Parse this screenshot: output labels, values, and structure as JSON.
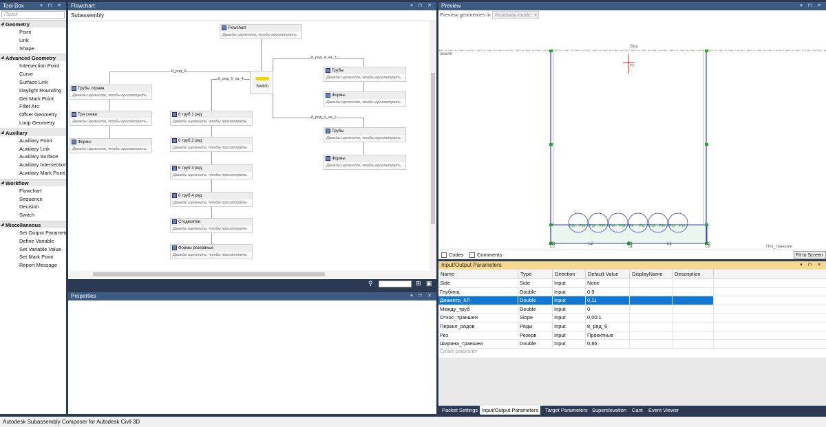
{
  "toolbox": {
    "title": "Tool Box",
    "search_placeholder": "Поиск",
    "categories": [
      {
        "name": "Geometry",
        "items": [
          "Point",
          "Link",
          "Shape"
        ]
      },
      {
        "name": "Advanced Geometry",
        "items": [
          "Intersection Point",
          "Curve",
          "Surface Link",
          "Daylight Rounding",
          "Get Mark Point",
          "Fillet Arc",
          "Offset Geometry",
          "Loop Geometry"
        ]
      },
      {
        "name": "Auxiliary",
        "items": [
          "Auxiliary Point",
          "Auxiliary Link",
          "Auxiliary Surface",
          "Auxiliary Intersection",
          "Auxiliary Mark Point"
        ]
      },
      {
        "name": "Workflow",
        "items": [
          "Flowchart",
          "Sequence",
          "Decision",
          "Switch"
        ]
      },
      {
        "name": "Miscellaneous",
        "items": [
          "Set Output Parameter",
          "Define Variable",
          "Set Variable Value",
          "Set Mark Point",
          "Report Message"
        ]
      }
    ]
  },
  "flowchart": {
    "title": "Flowchart",
    "breadcrumb": "Subassembly",
    "hint": "Дважды щелкните, чтобы просмотреть",
    "nodes": {
      "root": "Flowchart",
      "switch": "Switch",
      "a1": "Трубы справа",
      "a2": "Три слева",
      "a3": "Формы",
      "b1": "6 труб 1 ряд",
      "b2": "6 труб 2 ряд",
      "b3": "6 труб 3 ряд",
      "b4": "6 труб 4 ряд",
      "b5": "Стодесятки",
      "b6": "Формы резервные",
      "c1": "Трубы",
      "c2": "Формы",
      "d1": "Трубы",
      "d2": "Формы"
    },
    "edge_labels": {
      "left": "8_ряд_6",
      "mid": "8_ряд_6_на_4",
      "top_right": "8_ряд_4_на_3",
      "bot_right": "8_ряд_4_на_2"
    }
  },
  "preview": {
    "title": "Preview",
    "label": "Preview geometries in",
    "mode": "Roadway mode",
    "codes_label": "Codes",
    "comments_label": "Comments",
    "fit_button": "Fit to Screen",
    "axis_label": "Ось",
    "surface_label": "Земля",
    "bottom_label": "Низ_траншеи",
    "point_labels": [
      "L5",
      "S1",
      "L6",
      "P3",
      "L2",
      "P1",
      "L1",
      "P2",
      "P0"
    ],
    "pipe_labels": [
      "P20",
      "P39",
      "P18",
      "P37",
      "P16",
      "P35",
      "P8",
      "P11",
      "P28",
      "P30",
      "P12",
      "P14"
    ]
  },
  "properties": {
    "title": "Properties"
  },
  "io": {
    "title": "Input/Output Parameters",
    "columns": [
      "Name",
      "Type",
      "Direction",
      "Default Value",
      "DisplayName",
      "Description"
    ],
    "rows": [
      [
        "Side",
        "Side",
        "Input",
        "None",
        "",
        ""
      ],
      [
        "Глубина",
        "Double",
        "Input",
        "0,9",
        "",
        ""
      ],
      [
        "Диаметр_КЛ",
        "Double",
        "Input",
        "0,11",
        "",
        ""
      ],
      [
        "Между_труб",
        "Double",
        "Input",
        "0",
        "",
        ""
      ],
      [
        "Откос_траншеи",
        "Slope",
        "Input",
        "0,00:1",
        "",
        ""
      ],
      [
        "Перекл_рядов",
        "Ряды",
        "Input",
        "8_ряд_6",
        "",
        ""
      ],
      [
        "Рез",
        "Резерв",
        "Input",
        "Проектные",
        "",
        ""
      ],
      [
        "Ширина_траншеи",
        "Double",
        "Input",
        "0,86",
        "",
        ""
      ]
    ],
    "create_placeholder": "Create parameter"
  },
  "tabs": [
    "Packet Settings",
    "Input/Output Parameters",
    "Target Parameters",
    "Superelevation",
    "Cant",
    "Event Viewer"
  ],
  "status": "Autodesk Subassembly Composer for Autodesk Civil 3D",
  "colors": {
    "title_bar": "#3d5a80",
    "selection": "#1177d4",
    "active_title": "#f5d98e",
    "geometry": "#3b3bd6",
    "marker": "#22aa22"
  }
}
